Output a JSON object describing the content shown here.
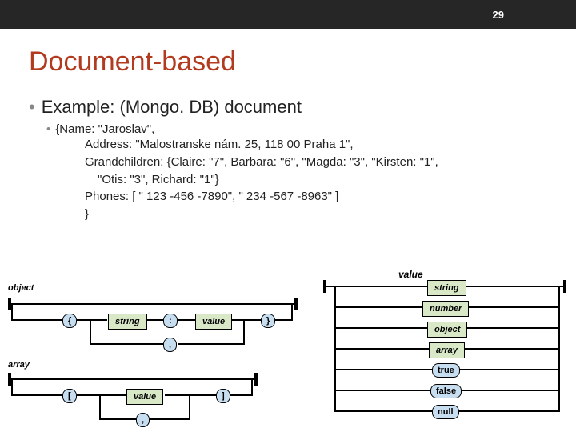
{
  "slide_number": "29",
  "title": "Document-based",
  "main_bullet": "Example: (Mongo. DB) document",
  "sub_bullet_lead": "{Name: \"Jaroslav\",",
  "code_lines": [
    "Address: \"Malostranske nám. 25, 118 00 Praha 1\",",
    "Grandchildren: {Claire: \"7\", Barbara: \"6\", \"Magda: \"3\", \"Kirsten: \"1\",",
    "  \"Otis: \"3\", Richard: \"1\"}",
    "Phones: [ \" 123 -456 -7890\", \" 234 -567 -8963\" ]",
    "}"
  ],
  "diagram": {
    "value_label": "value",
    "object_label": "object",
    "array_label": "array",
    "string_box": "string",
    "value_box": "value",
    "string_right": "string",
    "number_right": "number",
    "object_right": "object",
    "array_right": "array",
    "true_term": "true",
    "false_term": "false",
    "null_term": "null",
    "brace_open": "{",
    "brace_close": "}",
    "bracket_open": "[",
    "bracket_close": "]",
    "colon": ":",
    "comma": ","
  }
}
